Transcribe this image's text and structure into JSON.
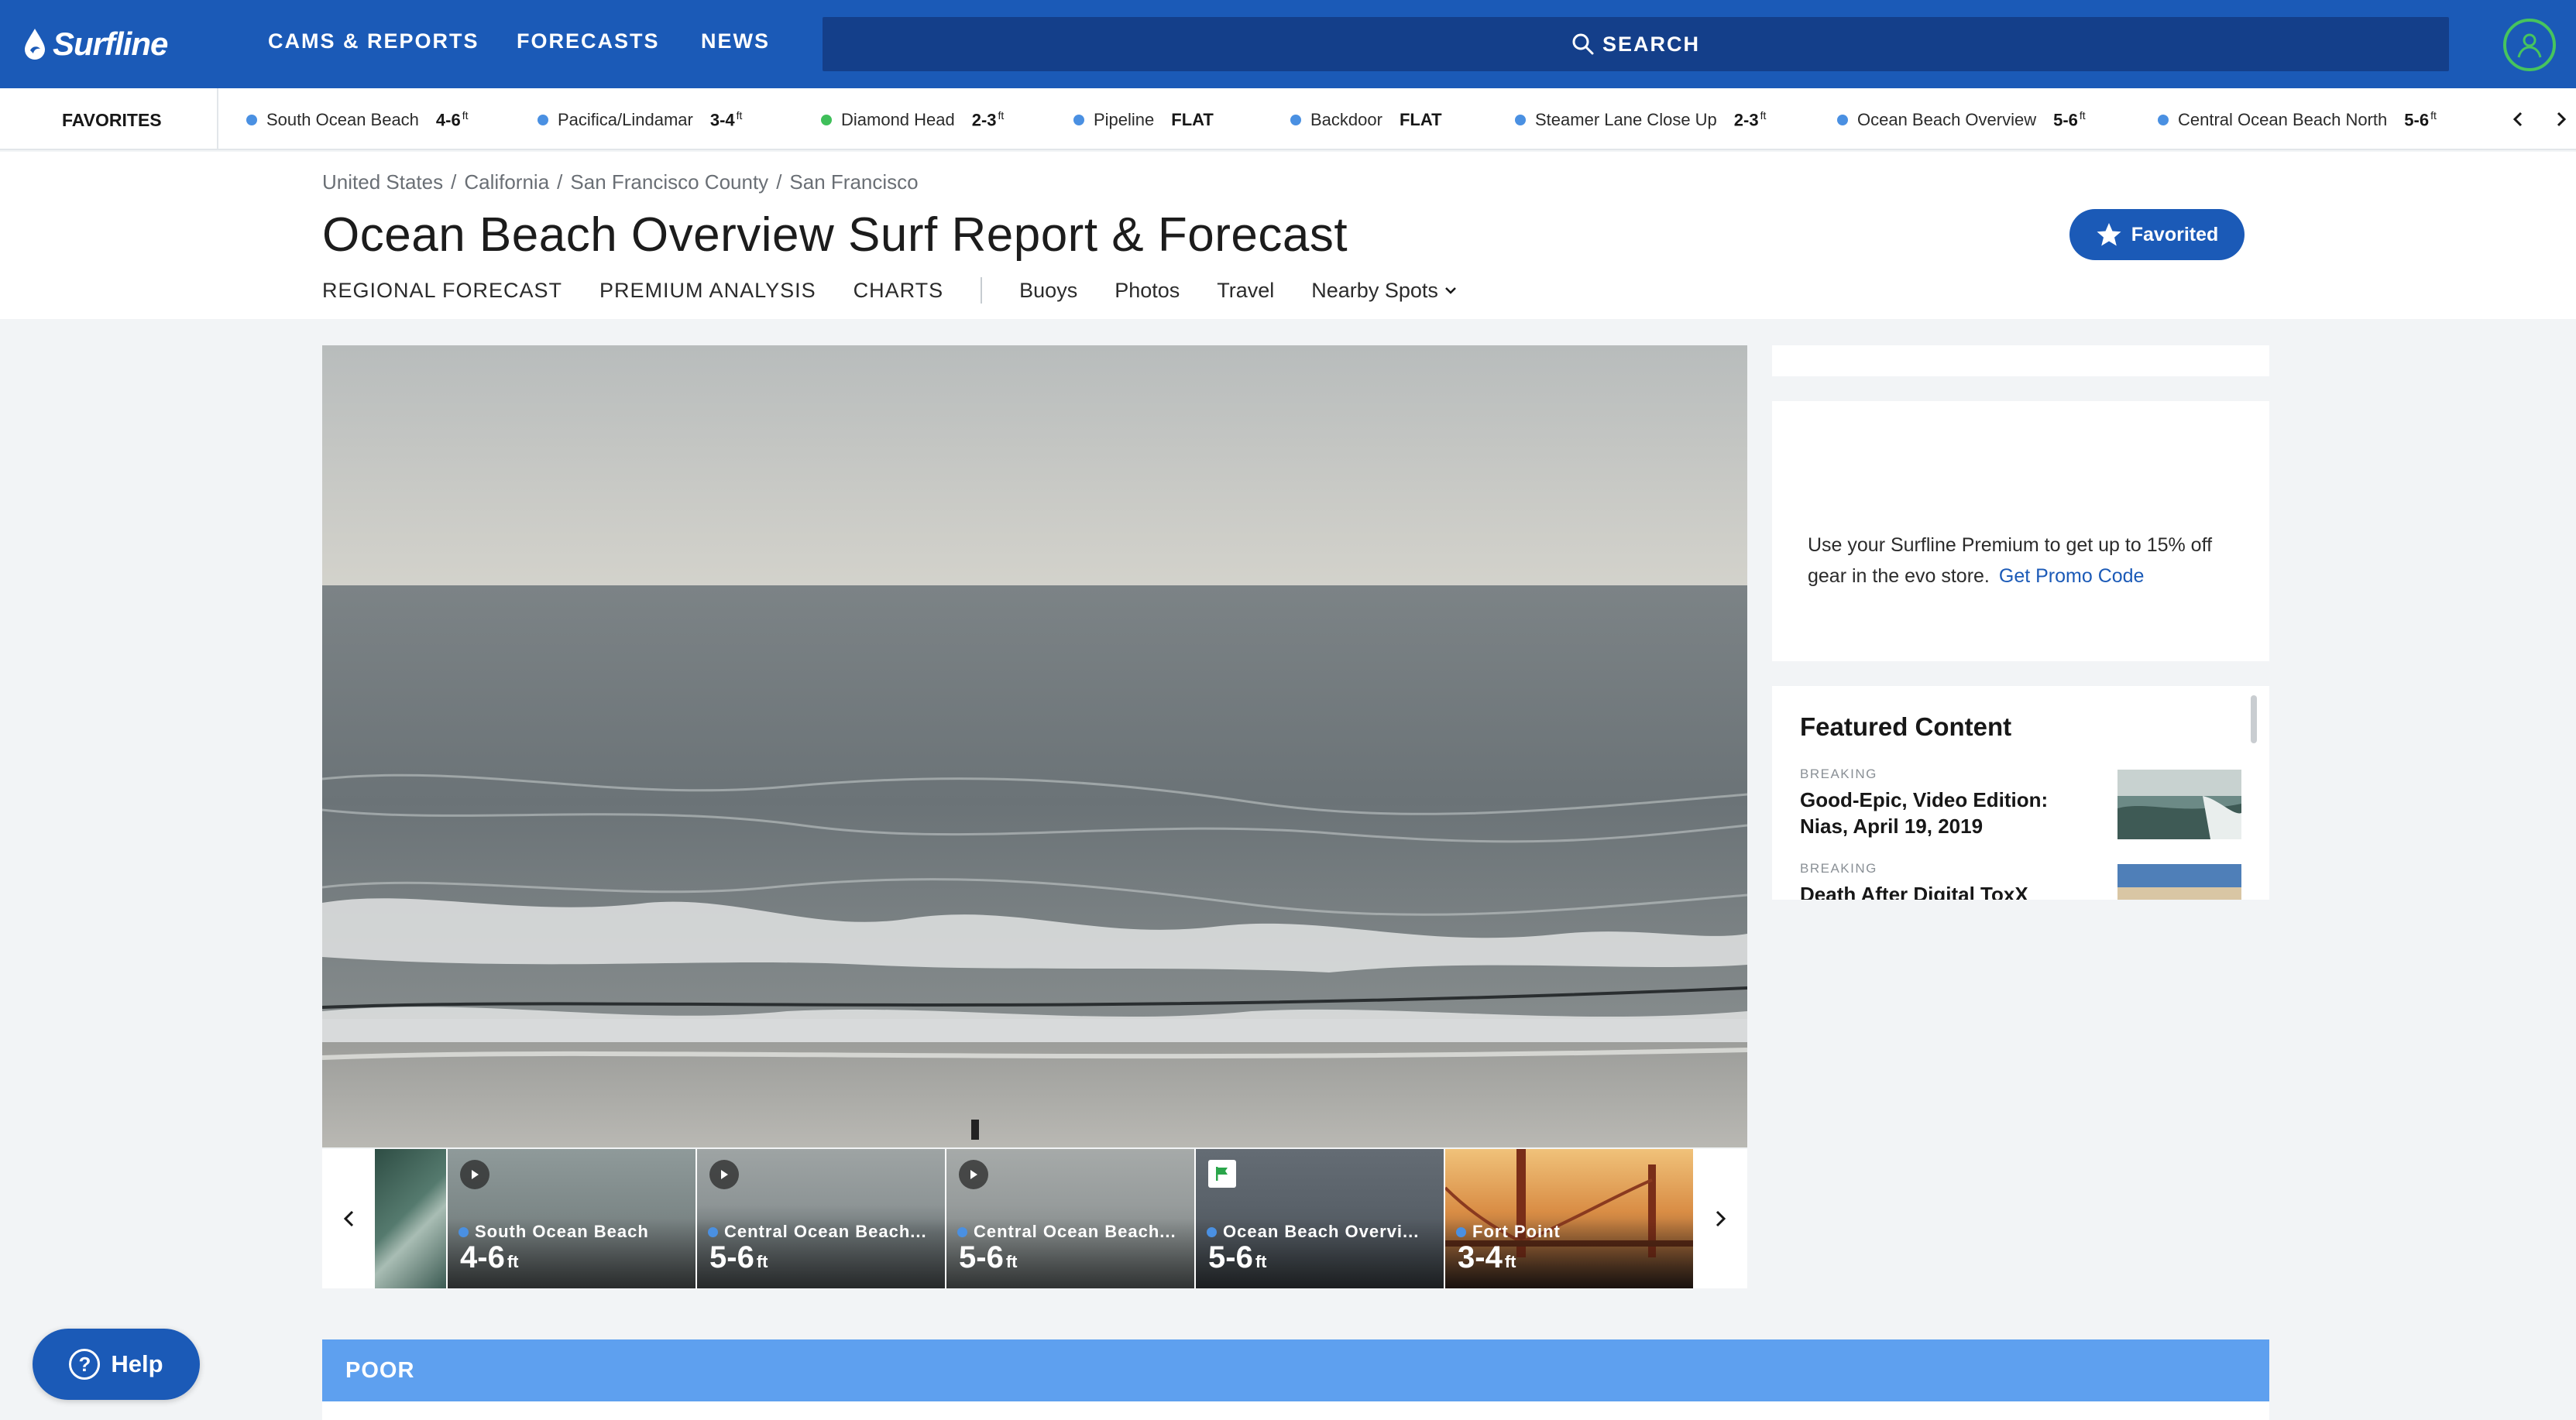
{
  "brand": {
    "logo_text": "Surfline"
  },
  "nav": {
    "cams": "CAMS & REPORTS",
    "forecasts": "FORECASTS",
    "news": "NEWS",
    "search": "SEARCH"
  },
  "favorites": {
    "label": "FAVORITES",
    "items": [
      {
        "name": "South Ocean Beach",
        "height": "4-6",
        "unit": "ft",
        "color": "#4a90e2"
      },
      {
        "name": "Pacifica/Lindamar",
        "height": "3-4",
        "unit": "ft",
        "color": "#4a90e2"
      },
      {
        "name": "Diamond Head",
        "height": "2-3",
        "unit": "ft",
        "color": "#3fbf5a"
      },
      {
        "name": "Pipeline",
        "height": "FLAT",
        "unit": "",
        "color": "#4a90e2"
      },
      {
        "name": "Backdoor",
        "height": "FLAT",
        "unit": "",
        "color": "#4a90e2"
      },
      {
        "name": "Steamer Lane Close Up",
        "height": "2-3",
        "unit": "ft",
        "color": "#4a90e2"
      },
      {
        "name": "Ocean Beach Overview",
        "height": "5-6",
        "unit": "ft",
        "color": "#4a90e2"
      },
      {
        "name": "Central Ocean Beach North",
        "height": "5-6",
        "unit": "ft",
        "color": "#4a90e2"
      }
    ]
  },
  "breadcrumb": [
    "United States",
    "/",
    "California",
    "/",
    "San Francisco County",
    "/",
    "San Francisco"
  ],
  "page": {
    "title": "Ocean Beach Overview Surf Report & Forecast",
    "favorited": "Favorited"
  },
  "subnav": {
    "regional": "REGIONAL FORECAST",
    "premium": "PREMIUM ANALYSIS",
    "charts": "CHARTS",
    "buoys": "Buoys",
    "photos": "Photos",
    "travel": "Travel",
    "nearby": "Nearby Spots"
  },
  "cams": [
    {
      "name": "South Ocean Beach",
      "height": "4-6",
      "unit": "ft",
      "icon": "play-icon"
    },
    {
      "name": "Central Ocean Beach...",
      "height": "5-6",
      "unit": "ft",
      "icon": "play-icon"
    },
    {
      "name": "Central Ocean Beach...",
      "height": "5-6",
      "unit": "ft",
      "icon": "play-icon"
    },
    {
      "name": "Ocean Beach Overvi...",
      "height": "5-6",
      "unit": "ft",
      "icon": "flag-icon"
    },
    {
      "name": "Fort Point",
      "height": "3-4",
      "unit": "ft",
      "icon": ""
    }
  ],
  "promo": {
    "text": "Use your Surfline Premium to get up to 15% off gear in the evo store.",
    "link": "Get Promo Code"
  },
  "featured": {
    "title": "Featured Content",
    "items": [
      {
        "tag": "BREAKING",
        "headline": "Good-Epic, Video Edition: Nias, April 19, 2019"
      },
      {
        "tag": "BREAKING",
        "headline": "Death After Digital ToxX"
      }
    ]
  },
  "condition": {
    "label": "POOR",
    "color": "#5ea0ef"
  },
  "help": {
    "label": "Help"
  },
  "colors": {
    "brand_blue": "#1b5ab7",
    "search_blue": "#143f8a",
    "account_ring": "#46c45e"
  }
}
